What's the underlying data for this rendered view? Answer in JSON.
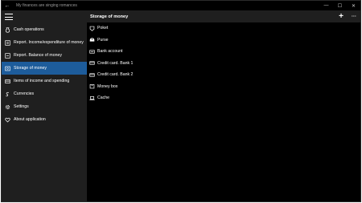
{
  "window": {
    "title": "My finances are singing romances"
  },
  "titlebar": {
    "back_glyph": "←",
    "minimize_glyph": "—",
    "maximize_glyph": "☐",
    "close_glyph": "✕"
  },
  "sidebar": {
    "items": [
      {
        "label": "Cash operations",
        "icon": "money-bag-icon",
        "active": false
      },
      {
        "label": "Report. Income/expenditure of money",
        "icon": "report-icon",
        "active": false
      },
      {
        "label": "Report. Balance of money",
        "icon": "report-balance-icon",
        "active": false
      },
      {
        "label": "Storage of money",
        "icon": "safe-icon",
        "active": true
      },
      {
        "label": "Items of income and spending",
        "icon": "list-icon",
        "active": false
      },
      {
        "label": "Currencies",
        "icon": "currency-icon",
        "active": false
      },
      {
        "label": "Settings",
        "icon": "gear-icon",
        "active": false
      },
      {
        "label": "About application",
        "icon": "heart-icon",
        "active": false
      }
    ]
  },
  "main": {
    "title": "Storage of money",
    "add_glyph": "+",
    "more_glyph": "···",
    "items": [
      {
        "label": "Poket",
        "icon": "pocket-icon"
      },
      {
        "label": "Purse",
        "icon": "purse-icon"
      },
      {
        "label": "Bank account",
        "icon": "bank-account-icon"
      },
      {
        "label": "Credit card. Bank 1",
        "icon": "credit-card-icon"
      },
      {
        "label": "Credit card. Bank 2",
        "icon": "credit-card-icon"
      },
      {
        "label": "Money box",
        "icon": "money-box-icon"
      },
      {
        "label": "Cache",
        "icon": "laptop-icon"
      }
    ]
  },
  "colors": {
    "accent": "#1d5c9b",
    "sidebar_bg": "#1f1f1f",
    "main_bg": "#000000"
  }
}
